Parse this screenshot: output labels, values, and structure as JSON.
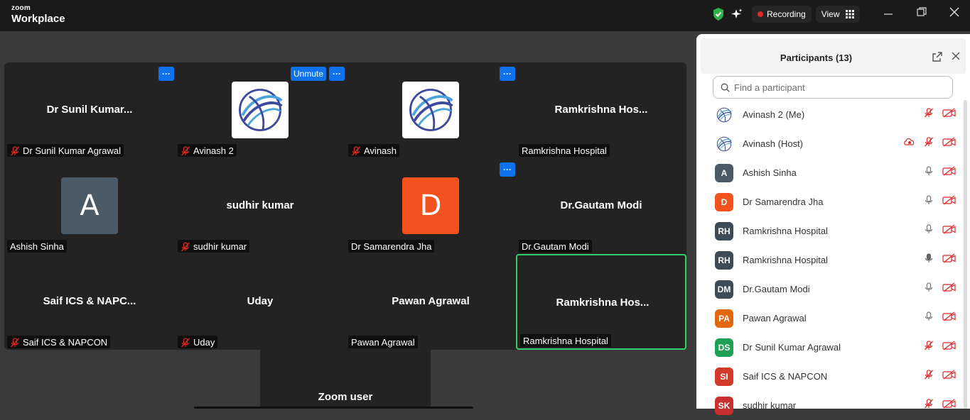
{
  "app": {
    "brand_small": "zoom",
    "brand_big": "Workplace"
  },
  "toolbar": {
    "recording_label": "Recording",
    "view_label": "View"
  },
  "tiles": [
    {
      "name": "Dr Sunil Kumar...",
      "label": "Dr Sunil Kumar Agrawal",
      "muted": true
    },
    {
      "name": "",
      "label": "Avinash 2",
      "muted": true,
      "logo": true
    },
    {
      "name": "",
      "label": "Avinash",
      "muted": true,
      "logo": true
    },
    {
      "name": "Ramkrishna  Hos...",
      "label": "Ramkrishna Hospital",
      "muted": false
    },
    {
      "name": "",
      "label": "Ashish Sinha",
      "muted": false,
      "letter": "A",
      "color": "#4a5a66"
    },
    {
      "name": "sudhir  kumar",
      "label": "sudhir  kumar",
      "muted": true
    },
    {
      "name": "",
      "label": "Dr Samarendra Jha",
      "muted": false,
      "letter": "D",
      "color": "#f2521e"
    },
    {
      "name": "Dr.Gautam Modi",
      "label": "Dr.Gautam Modi",
      "muted": false
    },
    {
      "name": "Saif ICS & NAPC...",
      "label": "Saif ICS & NAPCON",
      "muted": true
    },
    {
      "name": "Uday",
      "label": "Uday",
      "muted": true
    },
    {
      "name": "Pawan Agrawal",
      "label": "Pawan Agrawal",
      "muted": false
    },
    {
      "name": "Ramkrishna  Hos...",
      "label": "Ramkrishna Hospital",
      "muted": false,
      "active": true
    }
  ],
  "tile_controls": {
    "more": "···",
    "unmute": "Unmute"
  },
  "extra_tile": {
    "name": "Zoom user"
  },
  "panel": {
    "title": "Participants (13)",
    "search_placeholder": "Find a participant",
    "participants": [
      {
        "name": "Avinash 2 (Me)",
        "avatar": "logo",
        "mic": "muted",
        "video": "off"
      },
      {
        "name": "Avinash (Host)",
        "avatar": "logo",
        "mic": "muted",
        "video": "off",
        "recording": true
      },
      {
        "name": "Ashish Sinha",
        "initials": "A",
        "color": "#4a5a66",
        "mic": "on",
        "video": "off"
      },
      {
        "name": "Dr Samarendra Jha",
        "initials": "D",
        "color": "#f2521e",
        "mic": "on",
        "video": "off"
      },
      {
        "name": "Ramkrishna Hospital",
        "initials": "RH",
        "color": "#3d4b57",
        "mic": "on",
        "video": "off"
      },
      {
        "name": "Ramkrishna Hospital",
        "initials": "RH",
        "color": "#3d4b57",
        "mic": "speaking",
        "video": "off"
      },
      {
        "name": "Dr.Gautam Modi",
        "initials": "DM",
        "color": "#3d4b57",
        "mic": "on",
        "video": "off"
      },
      {
        "name": "Pawan Agrawal",
        "initials": "PA",
        "color": "#e3670f",
        "mic": "on",
        "video": "off"
      },
      {
        "name": "Dr Sunil Kumar Agrawal",
        "initials": "DS",
        "color": "#1fa155",
        "mic": "muted",
        "video": "off"
      },
      {
        "name": "Saif ICS & NAPCON",
        "initials": "SI",
        "color": "#d23a2a",
        "mic": "muted",
        "video": "off"
      },
      {
        "name": "sudhir  kumar",
        "initials": "SK",
        "color": "#c92f2f",
        "mic": "muted",
        "video": "off"
      }
    ]
  }
}
